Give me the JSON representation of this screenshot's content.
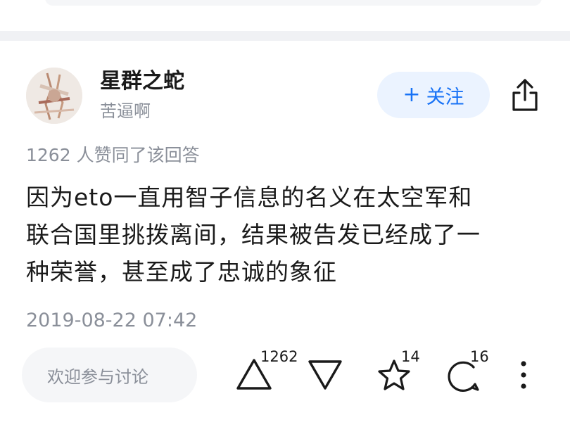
{
  "author": {
    "name": "星群之蛇",
    "bio": "苦逼啊"
  },
  "follow_button": {
    "label": "关注",
    "icon": "plus-icon"
  },
  "share_icon": "share-icon",
  "likes_line": "1262  人赞同了该回答",
  "answer": {
    "lines": [
      "因为eto一直用智子信息的名义在太空军和",
      "联合国里挑拨离间，结果被告发已经成了一",
      "种荣誉，甚至成了忠诚的象征"
    ]
  },
  "timestamp": "2019-08-22  07:42",
  "comment_input": {
    "placeholder": "欢迎参与讨论"
  },
  "actions": {
    "upvote_count": "1262",
    "downvote": "",
    "favorite_count": "14",
    "comment_count": "16"
  },
  "colors": {
    "accent": "#1772f6",
    "follow_bg": "#ebf3ff",
    "muted_text": "#8a8f99",
    "divider": "#f0f1f4"
  }
}
